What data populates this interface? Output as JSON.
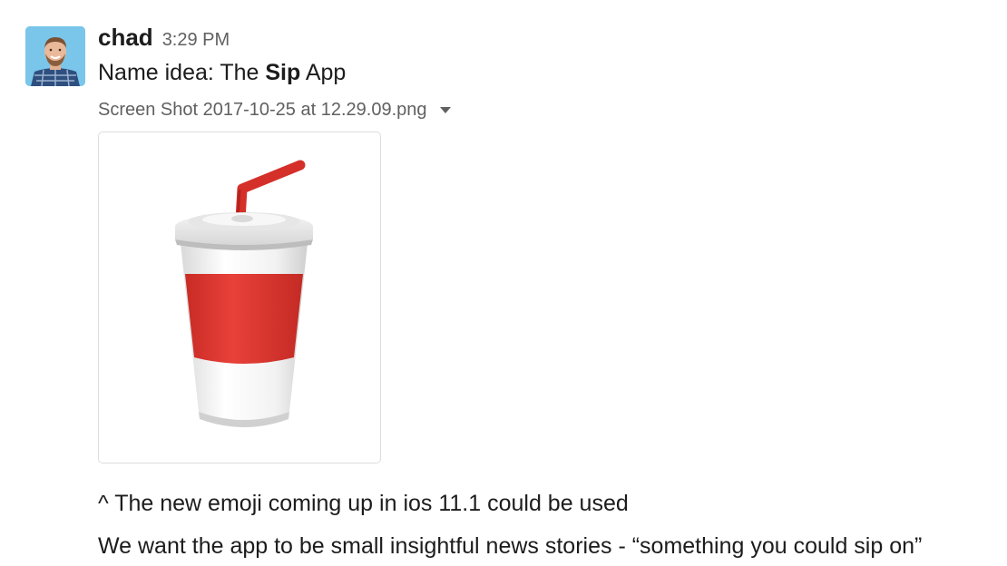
{
  "message": {
    "author": "chad",
    "timestamp": "3:29 PM",
    "line1_prefix": "Name idea: The ",
    "line1_bold": "Sip",
    "line1_suffix": " App",
    "attachment": {
      "filename": "Screen Shot 2017-10-25 at 12.29.09.png",
      "icon": "chevron-down-icon"
    },
    "line2": "^ The new emoji coming up in ios 11.1 could be used",
    "line3": "We want the app to be small insightful news stories - “something you could sip on”"
  },
  "colors": {
    "text": "#1d1c1d",
    "muted": "#616061",
    "cup_red": "#e23b34",
    "avatar_bg": "#79c6ea"
  }
}
